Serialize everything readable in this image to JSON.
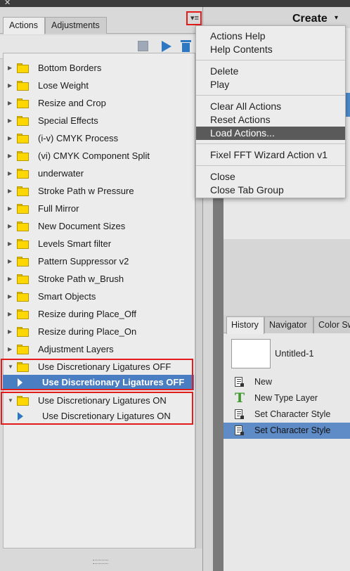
{
  "window": {
    "close_glyph": "✕"
  },
  "header": {
    "create_label": "Create",
    "create_caret": "▾"
  },
  "actions_panel": {
    "tabs": [
      {
        "label": "Actions",
        "active": true
      },
      {
        "label": "Adjustments",
        "active": false
      }
    ],
    "menu_button_icon": "panel-menu-icon",
    "toolbar": {
      "stop_icon": "stop-icon",
      "play_icon": "play-icon",
      "delete_icon": "trash-icon",
      "accent_color": "#2e77c3"
    },
    "items": [
      {
        "label": "Bottom Borders",
        "expanded": false
      },
      {
        "label": "Lose Weight",
        "expanded": false
      },
      {
        "label": "Resize and Crop",
        "expanded": false
      },
      {
        "label": "Special Effects",
        "expanded": false
      },
      {
        "label": "(i-v) CMYK Process",
        "expanded": false
      },
      {
        "label": "(vi) CMYK Component Split",
        "expanded": false
      },
      {
        "label": "underwater",
        "expanded": false
      },
      {
        "label": "Stroke Path w Pressure",
        "expanded": false
      },
      {
        "label": "Full Mirror",
        "expanded": false
      },
      {
        "label": "New Document Sizes",
        "expanded": false
      },
      {
        "label": "Levels Smart filter",
        "expanded": false
      },
      {
        "label": "Pattern Suppressor v2",
        "expanded": false
      },
      {
        "label": "Stroke Path w_Brush",
        "expanded": false
      },
      {
        "label": "Smart Objects",
        "expanded": false
      },
      {
        "label": "Resize during Place_Off",
        "expanded": false
      },
      {
        "label": "Resize during Place_On",
        "expanded": false
      },
      {
        "label": "Adjustment Layers",
        "expanded": false
      },
      {
        "label": "Use Discretionary Ligatures OFF",
        "expanded": true,
        "children": [
          {
            "label": "Use Discretionary Ligatures OFF",
            "selected": true
          }
        ]
      },
      {
        "label": "Use Discretionary Ligatures ON",
        "expanded": true,
        "children": [
          {
            "label": "Use Discretionary Ligatures ON",
            "selected": false
          }
        ]
      }
    ],
    "selection_color": "#4a7ec2",
    "highlight_color": "#e31b1b"
  },
  "panel_menu": {
    "groups": [
      [
        "Actions Help",
        "Help Contents"
      ],
      [
        "Delete",
        "Play"
      ],
      [
        "Clear All Actions",
        "Reset Actions",
        "Load Actions..."
      ],
      [
        "Fixel FFT Wizard Action v1"
      ],
      [
        "Close",
        "Close Tab Group"
      ]
    ],
    "highlighted_item": "Load Actions..."
  },
  "history_panel": {
    "tabs": [
      {
        "label": "History",
        "active": true
      },
      {
        "label": "Navigator",
        "active": false
      },
      {
        "label": "Color Sw",
        "active": false
      }
    ],
    "snapshot_label": "Untitled-1",
    "steps": [
      {
        "label": "New",
        "icon": "document-icon",
        "selected": false
      },
      {
        "label": "New Type Layer",
        "icon": "type-tool-icon",
        "selected": false
      },
      {
        "label": "Set Character Style",
        "icon": "document-icon",
        "selected": false
      },
      {
        "label": "Set Character Style",
        "icon": "document-icon",
        "selected": true
      }
    ],
    "type_icon_glyph": "T"
  }
}
